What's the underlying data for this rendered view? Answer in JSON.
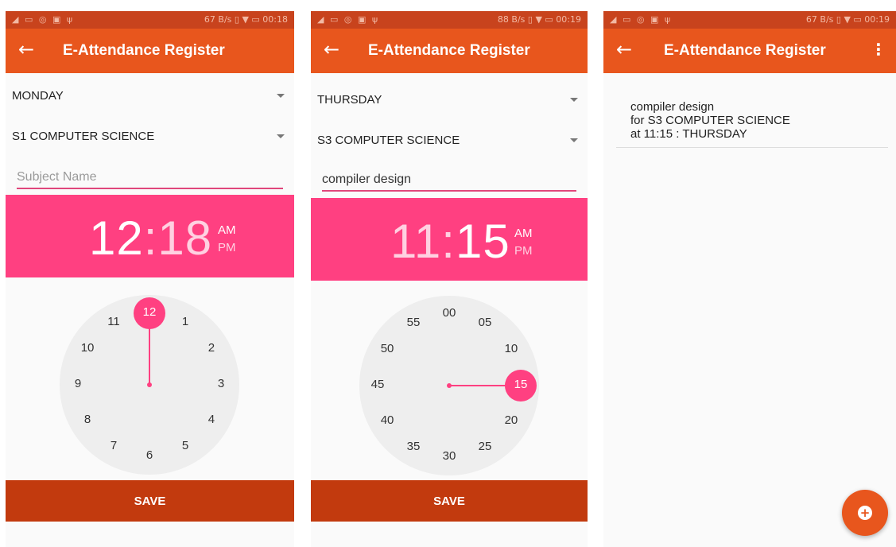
{
  "app_title": "E-Attendance Register",
  "save_label": "SAVE",
  "screens": [
    {
      "status": {
        "left": "◢ ▭ ◎ ▣ ψ",
        "right": "67 B/s ▯ ▼ ▭ 00:18"
      },
      "day": "MONDAY",
      "class_name": "S1 COMPUTER SCIENCE",
      "subject_placeholder": "Subject Name",
      "time": {
        "hour": "12",
        "sep": ":",
        "minute": "18",
        "am": "AM",
        "pm": "PM"
      },
      "dial_labels": [
        "12",
        "1",
        "2",
        "3",
        "4",
        "5",
        "6",
        "7",
        "8",
        "9",
        "10",
        "11"
      ],
      "dial_selected": "12"
    },
    {
      "status": {
        "left": "◢ ▭ ◎ ▣ ψ",
        "right": "88 B/s ▯ ▼ ▭ 00:19"
      },
      "day": "THURSDAY",
      "class_name": "S3 COMPUTER SCIENCE",
      "subject_value": "compiler design",
      "time": {
        "hour": "11",
        "sep": ":",
        "minute": "15",
        "am": "AM",
        "pm": "PM"
      },
      "dial_labels": [
        "00",
        "05",
        "10",
        "15",
        "20",
        "25",
        "30",
        "35",
        "40",
        "45",
        "50",
        "55"
      ],
      "dial_selected": "15"
    },
    {
      "status": {
        "left": "◢ ▭ ◎ ▣ ψ",
        "right": "67 B/s ▯ ▼ ▭ 00:19"
      },
      "entries": [
        {
          "subject": "compiler design",
          "for_line": "for S3 COMPUTER SCIENCE",
          "at_line": "at 11:15 : THURSDAY"
        }
      ]
    }
  ]
}
